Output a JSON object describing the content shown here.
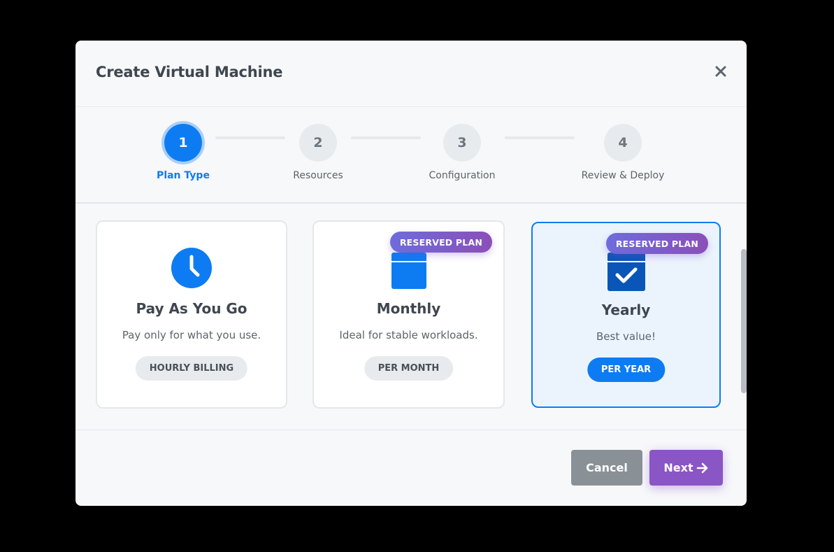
{
  "modal": {
    "title": "Create Virtual Machine",
    "close_icon": "close-icon"
  },
  "steps": [
    {
      "number": "1",
      "label": "Plan Type",
      "active": true
    },
    {
      "number": "2",
      "label": "Resources",
      "active": false
    },
    {
      "number": "3",
      "label": "Configuration",
      "active": false
    },
    {
      "number": "4",
      "label": "Review & Deploy",
      "active": false
    }
  ],
  "plans": [
    {
      "title": "Pay As You Go",
      "description": "Pay only for what you use.",
      "badge": "HOURLY BILLING",
      "ribbon": "",
      "icon": "clock-icon",
      "selected": false
    },
    {
      "title": "Monthly",
      "description": "Ideal for stable workloads.",
      "badge": "PER MONTH",
      "ribbon": "RESERVED PLAN",
      "icon": "calendar-icon",
      "selected": false
    },
    {
      "title": "Yearly",
      "description": "Best value!",
      "badge": "PER YEAR",
      "ribbon": "RESERVED PLAN",
      "icon": "calendar-check-icon",
      "selected": true
    }
  ],
  "footer": {
    "cancel_label": "Cancel",
    "next_label": "Next",
    "next_icon": "arrow-right-icon"
  },
  "colors": {
    "primary": "#0d7cf2",
    "accent": "#8a55c5",
    "cancel": "#8a9196"
  }
}
